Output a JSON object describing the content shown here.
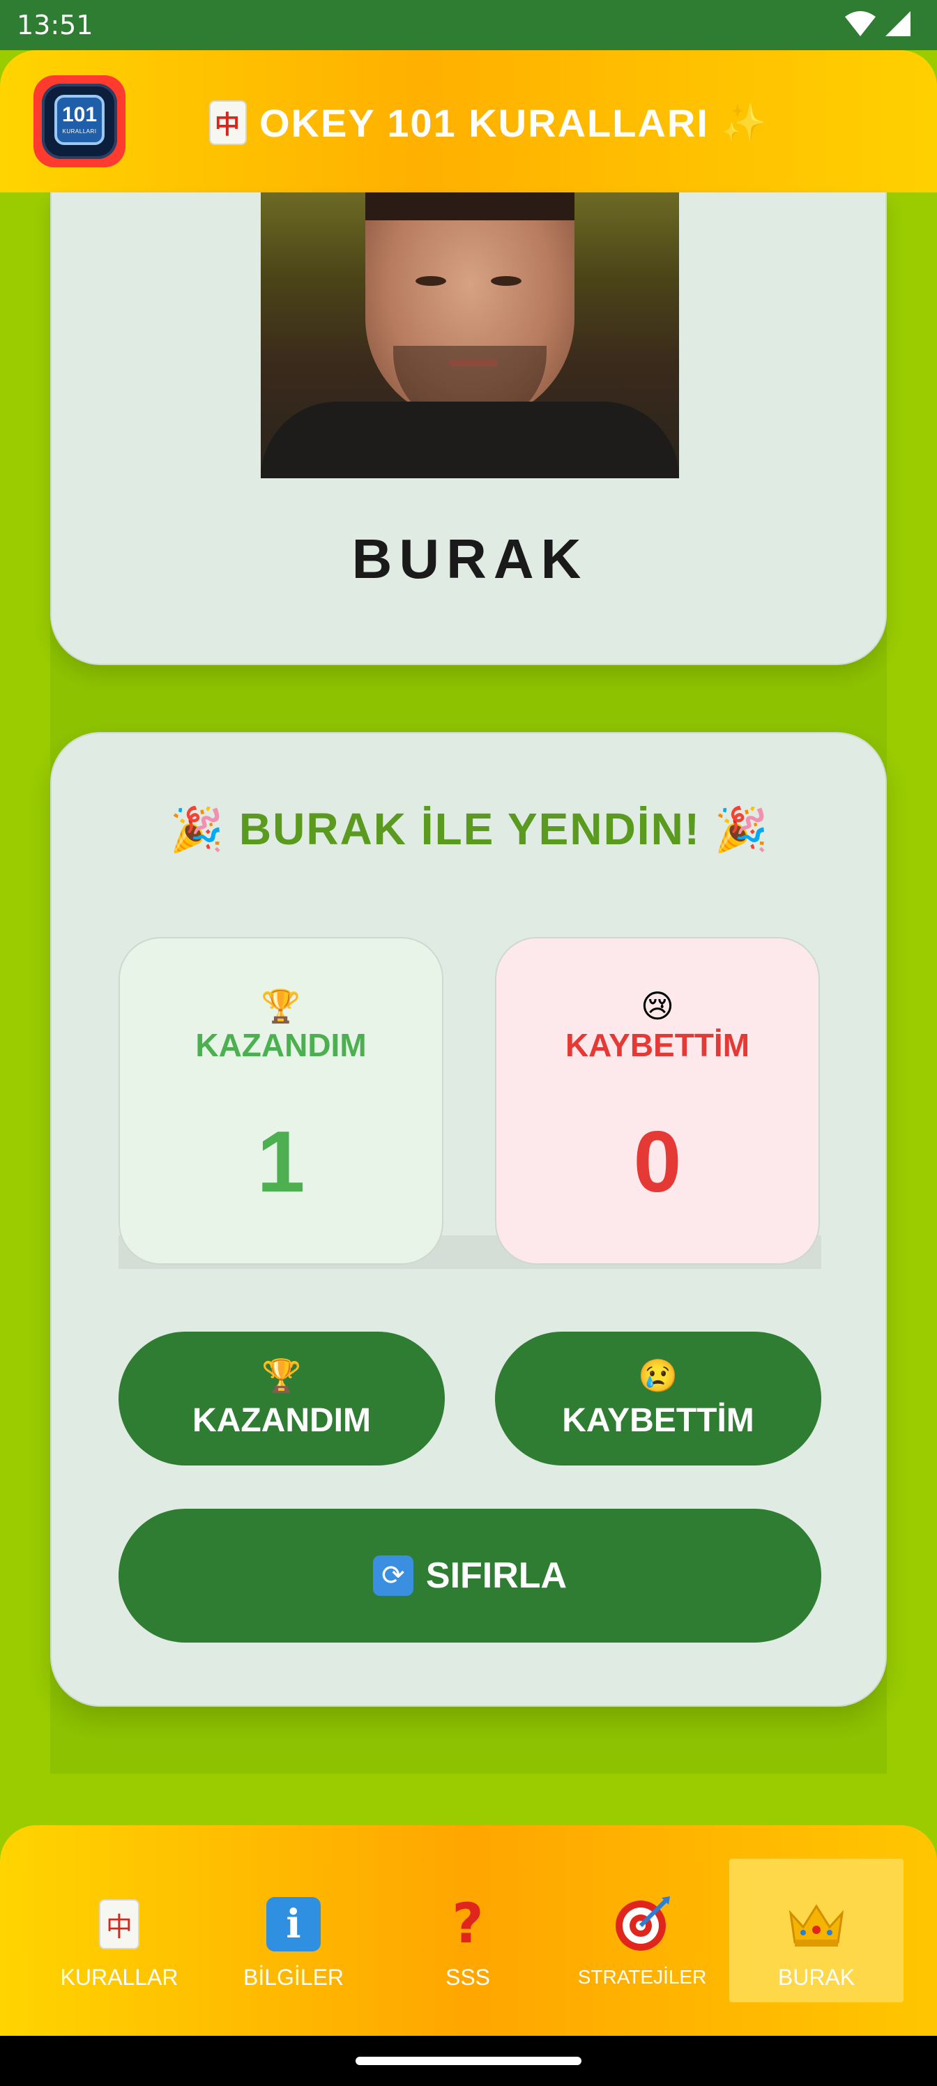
{
  "status_bar": {
    "time": "13:51",
    "icons": [
      "wifi-icon",
      "signal-icon",
      "battery-icon"
    ]
  },
  "app_bar": {
    "app_icon_number": "101",
    "app_icon_caption": "KURALLARI",
    "title": "OKEY 101 KURALLARI",
    "title_prefix_icon": "mahjong-tile-icon",
    "title_suffix_glyph": "✨",
    "colors": {
      "gradient_start": "#ffd400",
      "gradient_mid": "#ffb000",
      "gradient_end": "#ffd000"
    }
  },
  "profile": {
    "name": "BURAK",
    "photo": "profile-photo"
  },
  "score": {
    "headline": "BURAK İLE YENDİN!",
    "headline_emoji": "🎉",
    "win": {
      "emoji": "🏆",
      "label": "KAZANDIM",
      "value": "1",
      "color": "#4caf50"
    },
    "lose": {
      "emoji": "😢",
      "label": "KAYBETTİM",
      "value": "0",
      "color": "#e53935"
    }
  },
  "actions": {
    "win_button": {
      "emoji": "🏆",
      "label": "KAZANDIM"
    },
    "lose_button": {
      "emoji": "😢",
      "label": "KAYBETTİM"
    },
    "reset_button": {
      "icon": "refresh-icon",
      "glyph": "🔄",
      "label": "SIFIRLA"
    },
    "button_color": "#2e7d32"
  },
  "bottom_nav": {
    "items": [
      {
        "label": "KURALLAR",
        "icon": "mahjong-tile-icon",
        "active": false
      },
      {
        "label": "BİLGİLER",
        "icon": "info-icon",
        "active": false
      },
      {
        "label": "SSS",
        "icon": "question-icon",
        "active": false
      },
      {
        "label": "STRATEJİLER",
        "icon": "target-icon",
        "active": false
      },
      {
        "label": "BURAK",
        "icon": "crown-icon",
        "active": true
      }
    ]
  },
  "colors": {
    "background": "#9acc00",
    "card": "#e0ebe3",
    "status_bar": "#2e7d32"
  }
}
